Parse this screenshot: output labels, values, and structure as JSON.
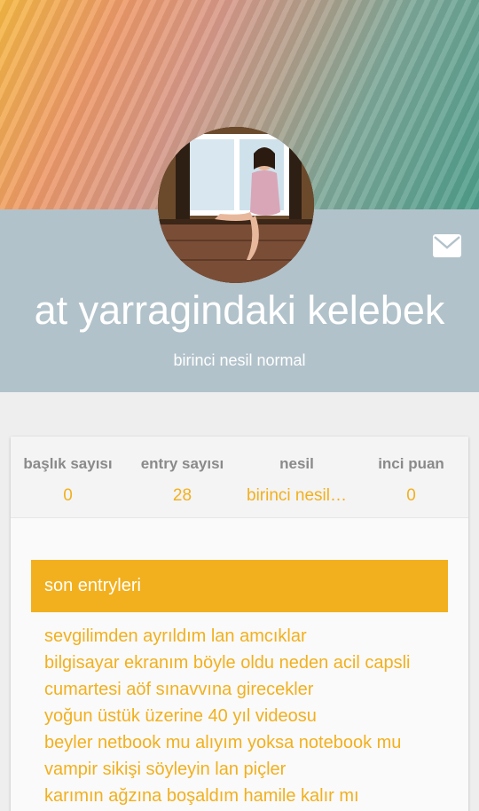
{
  "profile": {
    "username": "at yarragindaki kelebek",
    "rank": "birinci nesil normal",
    "mail_icon": "envelope-icon",
    "accent_color": "#f2b01e",
    "band_color": "#b2c2ca"
  },
  "stats": [
    {
      "label": "başlık sayısı",
      "value": "0"
    },
    {
      "label": "entry sayısı",
      "value": "28"
    },
    {
      "label": "nesil",
      "value": "birinci nesil…"
    },
    {
      "label": "inci puan",
      "value": "0"
    }
  ],
  "recent": {
    "title": "son entryleri",
    "items": [
      "sevgilimden ayrıldım lan amcıklar",
      "bilgisayar ekranım böyle oldu neden acil capsli",
      "cumartesi aöf sınavvına girecekler",
      "yoğun üstük üzerine 40 yıl videosu",
      "beyler netbook mu alıyım yoksa notebook mu",
      "vampir sikişi söyleyin lan piçler",
      "karımın ağzına boşaldım hamile kalır mı"
    ]
  }
}
